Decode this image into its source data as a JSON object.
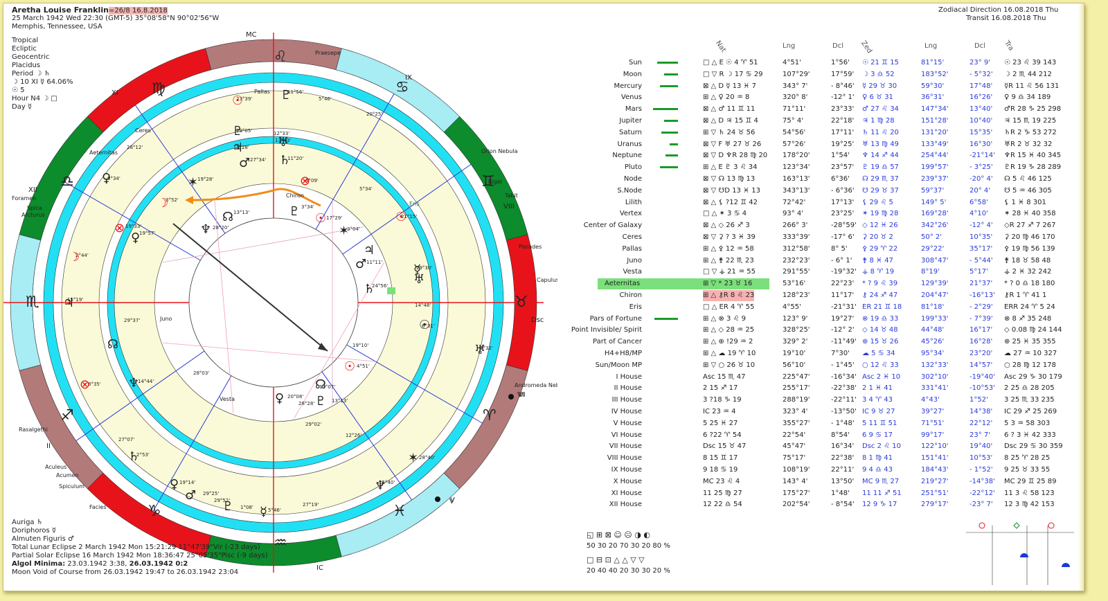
{
  "header": {
    "name": "Aretha Louise Franklin",
    "name_suffix": "=26/8 16.8.2018",
    "date_line": "25 March 1942  Wed  22:30 (GMT-5) 35°08'58\"N  90°02'56\"W",
    "place": "Memphis, Tennessee, USA",
    "settings": [
      "Tropical",
      "Ecliptic",
      "Geocentric",
      "Placidus"
    ],
    "period": "Period ☽ ♄",
    "period2": "☽ 10 XI ☿ 64.06%",
    "period3": "☉ 5",
    "hour": "Hour N4 ☽ □",
    "day": "Day ☿"
  },
  "top_right": {
    "line1": "Zodiacal Direction 16.08.2018  Thu",
    "line2": "Transit 16.08.2018  Thu"
  },
  "bottom_left": {
    "auriga": "Auriga ♄",
    "doriphoros": "Doriphoros ☿",
    "almuten": "Almuten Figuris ♂",
    "lunar": "Total Lunar Eclipse 2 March 1942 Mon 1",
    "lunar_tail": "5:21:29 11°47'39\"Vir (-23 days)",
    "solar": "Partial Solar Eclipse 16 March 1942 Mon 18:36:47 25°05'35\"Pisc (-9 days)",
    "algol_label": "Algol Minima:",
    "algol_vals": "23.03.1942  3:38,",
    "algol_bold": "26.03.1942  0:2",
    "void": "Moon Void of Course from 26.03.1942 19:47 to 26.03.1942 23:04"
  },
  "bottom_stats": {
    "row1_symbols": "◱ ⊞ ⊠   ☺ ☹ ◑ ◐",
    "row1_vals": "50  30  20    70  30  20  80 %",
    "row2_symbols": "□ ⊟ ⊡   △ △ ▽ ▽",
    "row2_vals": "20  40  40    20  30  30  20 %"
  },
  "table_headers": {
    "nat": "Nat",
    "lng": "Lng",
    "dcl": "Dcl",
    "zed": "Zed",
    "tra": "Tra"
  },
  "rows": [
    {
      "label": "Sun",
      "nat": "□ △ E ☉  4 ♈ 51",
      "lng": "4°51'",
      "dcl": "1°56'",
      "zed": "☉  21 ♊ 15",
      "zlng": "81°15'",
      "zdcl": "23° 9'",
      "tra": "☉ 23 ♌ 39  143"
    },
    {
      "label": "Moon",
      "nat": "□ ▽ R ☽  17 ♋ 29",
      "lng": "107°29'",
      "dcl": "17°59'",
      "zed": "☽  3 ♎ 52",
      "zlng": "183°52'",
      "zdcl": "- 5°32'",
      "tra": "☽ 2 ♏ 44  212"
    },
    {
      "label": "Mercury",
      "nat": "⊠ △ D ☿  13 ♓  7",
      "lng": "343° 7'",
      "dcl": "- 8°46'",
      "zed": "☿  29 ♉ 30",
      "zlng": "59°30'",
      "zdcl": "17°48'",
      "tra": "☿R 11 ♌ 56  131"
    },
    {
      "label": "Venus",
      "nat": "⊞ △   ♀  20 ♒  8",
      "lng": "320° 8'",
      "dcl": "-12° 1'",
      "zed": "♀  6 ♉ 31",
      "zlng": "36°31'",
      "zdcl": "16°26'",
      "tra": "♀ 9 ♎ 34  189"
    },
    {
      "label": "Mars",
      "nat": "⊠ △   ♂  11 ♊ 11",
      "lng": "71°11'",
      "dcl": "23°33'",
      "zed": "♂  27 ♌ 34",
      "zlng": "147°34'",
      "zdcl": "13°40'",
      "tra": "♂R 28 ♑ 25  298"
    },
    {
      "label": "Jupiter",
      "nat": "⊠ △ D ♃  15 ♊  4",
      "lng": "75° 4'",
      "dcl": "22°18'",
      "zed": "♃  1 ♍ 28",
      "zlng": "151°28'",
      "zdcl": "10°40'",
      "tra": "♃ 15 ♏ 19  225"
    },
    {
      "label": "Saturn",
      "nat": "⊞ ▽   ♄  24 ♉ 56",
      "lng": "54°56'",
      "dcl": "17°11'",
      "zed": "♄  11 ♌ 20",
      "zlng": "131°20'",
      "zdcl": "15°35'",
      "tra": "♄R 2 ♑ 53  272"
    },
    {
      "label": "Uranus",
      "nat": "⊠ ▽ F ♅  27 ♉ 26",
      "lng": "57°26'",
      "dcl": "19°25'",
      "zed": "♅  13 ♍ 49",
      "zlng": "133°49'",
      "zdcl": "16°30'",
      "tra": "♅R 2 ♉ 32  32"
    },
    {
      "label": "Neptune",
      "nat": "⊠ ▽ D ♆R 28 ♍ 20",
      "lng": "178°20'",
      "dcl": "1°54'",
      "zed": "♆  14 ♐ 44",
      "zlng": "254°44'",
      "zdcl": "-21°14'",
      "tra": "♆R 15 ♓ 40  345"
    },
    {
      "label": "Pluto",
      "nat": "⊞ △ E ♇  3 ♌ 34",
      "lng": "123°34'",
      "dcl": "23°57'",
      "zed": "♇  19 ♎ 57",
      "zlng": "199°57'",
      "zdcl": "- 3°25'",
      "tra": "♇R 19 ♑ 28  289"
    },
    {
      "label": "Node",
      "nat": "⊠ ▽   ☊  13 ♍ 13",
      "lng": "163°13'",
      "dcl": "6°36'",
      "zed": "☊  29 ♏ 37",
      "zlng": "239°37'",
      "zdcl": "-20° 4'",
      "tra": "☊ 5 ♌ 46  125"
    },
    {
      "label": "S.Node",
      "nat": "⊠ ▽   ☋D 13 ♓ 13",
      "lng": "343°13'",
      "dcl": "- 6°36'",
      "zed": "☋  29 ♉ 37",
      "zlng": "59°37'",
      "zdcl": "20° 4'",
      "tra": "☋ 5 ♒ 46  305"
    },
    {
      "label": "Lilith",
      "nat": "⊠ △   ⚸ ?12 ♊ 42",
      "lng": "72°42'",
      "dcl": "17°13'",
      "zed": "⚸  29 ♌  5",
      "zlng": "149° 5'",
      "zdcl": "6°58'",
      "tra": "⚸ 1 ♓  8  301"
    },
    {
      "label": "Vertex",
      "nat": "□ △   ✶  3 ♋  4",
      "lng": "93° 4'",
      "dcl": "23°25'",
      "zed": "✶  19 ♍ 28",
      "zlng": "169°28'",
      "zdcl": "4°10'",
      "tra": "✶ 28 ♓ 40  358"
    },
    {
      "label": "Center of Galaxy",
      "nat": "⊠ △   ◇  26 ♐  3",
      "lng": "266° 3'",
      "dcl": "-28°59'",
      "zed": "◇  12 ♓ 26",
      "zlng": "342°26'",
      "zdcl": "-12° 4'",
      "tra": "◇R 27 ♐  7  267"
    },
    {
      "label": "Ceres",
      "nat": "⊠ ▽   ⚳  ? 3 ♓ 39",
      "lng": "333°39'",
      "dcl": "-17° 6'",
      "zed": "⚳  20 ♉  2",
      "zlng": "50° 2'",
      "zdcl": "10°35'",
      "tra": "⚳ 20 ♍ 46  170"
    },
    {
      "label": "Pallas",
      "nat": "⊞ △   ⚴  12 ♒ 58",
      "lng": "312°58'",
      "dcl": "8° 5'",
      "zed": "⚴  29 ♈ 22",
      "zlng": "29°22'",
      "zdcl": "35°17'",
      "tra": "⚴ 19 ♍ 56  139"
    },
    {
      "label": "Juno",
      "nat": "⊞ △   ⚵  22 ♏ 23",
      "lng": "232°23'",
      "dcl": "- 6° 1'",
      "zed": "⚵  8 ♓ 47",
      "zlng": "308°47'",
      "zdcl": "- 5°44'",
      "tra": "⚵ 18 ♉ 58  48"
    },
    {
      "label": "Vesta",
      "nat": "□ ▽   ⚶  21 ♒ 55",
      "lng": "291°55'",
      "dcl": "-19°32'",
      "zed": "⚶  8 ♈ 19",
      "zlng": "8°19'",
      "zdcl": "5°17'",
      "tra": "⚶ 2 ♓ 32  242"
    },
    {
      "label": "Aeternitas",
      "nat": "⊞ ▽   *  23 ♉ 16",
      "lng": "53°16'",
      "dcl": "22°23'",
      "zed": "* ? 9 ♌ 39",
      "zlng": "129°39'",
      "zdcl": "21°37'",
      "tra": "* ? 0 ♎ 18  180"
    },
    {
      "label": "Chiron",
      "nat": "⊞ △   ⚷R 8 ♌ 23",
      "lng": "128°23'",
      "dcl": "11°17'",
      "zed": "⚷  24 ♐ 47",
      "zlng": "204°47'",
      "zdcl": "-16°13'",
      "tra": "⚷R 1 ♈ 41  1"
    },
    {
      "label": "Eris",
      "nat": "□ △   ER  4 ♈ 55",
      "lng": "4°55'",
      "dcl": "-21°31'",
      "zed": "ER  21 ♊ 18",
      "zlng": "81°18'",
      "zdcl": "- 2°29'",
      "tra": "ERR 24 ♈  5  24"
    },
    {
      "label": "Pars of Fortune",
      "nat": "⊞ △   ⊗  3 ♌  9",
      "lng": "123° 9'",
      "dcl": "19°27'",
      "zed": "⊗  19 ♎ 33",
      "zlng": "199°33'",
      "zdcl": "- 7°39'",
      "tra": "⊗ 8 ♐ 35  248"
    },
    {
      "label": "Point Invisible/ Spirit",
      "nat": "⊞ △   ◇  28 ♒ 25",
      "lng": "328°25'",
      "dcl": "-12° 2'",
      "zed": "◇  14 ♉ 48",
      "zlng": "44°48'",
      "zdcl": "16°17'",
      "tra": "◇ 0.08 ♍ 24  144"
    },
    {
      "label": "Part of Cancer",
      "nat": "⊞ △   ⊕ !29 ♒  2",
      "lng": "329° 2'",
      "dcl": "-11°49'",
      "zed": "⊕  15 ♉ 26",
      "zlng": "45°26'",
      "zdcl": "16°28'",
      "tra": "⊕ 25 ♓ 35  355"
    },
    {
      "label": "H4+H8/MP",
      "nat": "⊞ △   ☁  19 ♈ 10",
      "lng": "19°10'",
      "dcl": "7°30'",
      "zed": "☁  5 ♋ 34",
      "zlng": "95°34'",
      "zdcl": "23°20'",
      "tra": "☁ 27 ♒ 10  327"
    },
    {
      "label": "Sun/Moon MP",
      "nat": "⊞ ▽   ○  26 ♉ 10",
      "lng": "56°10'",
      "dcl": "- 1°45'",
      "zed": "○  12 ♌ 33",
      "zlng": "132°33'",
      "zdcl": "14°57'",
      "tra": "○ 28 ♍ 12  178"
    },
    {
      "label": "I House",
      "nat": "Asc 15 ♏ 47",
      "lng": "225°47'",
      "dcl": "-16°34'",
      "zed": "Asc 2 ♓ 10",
      "zlng": "302°10'",
      "zdcl": "-19°40'",
      "tra": "Asc 29 ♑ 30  179"
    },
    {
      "label": "II House",
      "nat": "2  15 ♐ 17",
      "lng": "255°17'",
      "dcl": "-22°38'",
      "zed": "2  1 ♓ 41",
      "zlng": "331°41'",
      "zdcl": "-10°53'",
      "tra": "2  25 ♎ 28  205"
    },
    {
      "label": "III House",
      "nat": "3  ?18 ♑ 19",
      "lng": "288°19'",
      "dcl": "-22°11'",
      "zed": "3  4 ♈ 43",
      "zlng": "4°43'",
      "zdcl": "1°52'",
      "tra": "3  25 ♏ 33  235"
    },
    {
      "label": "IV House",
      "nat": "IC 23 ♒  4",
      "lng": "323° 4'",
      "dcl": "-13°50'",
      "zed": "IC 9 ♉ 27",
      "zlng": "39°27'",
      "zdcl": "14°38'",
      "tra": "IC 29 ♐ 25  269"
    },
    {
      "label": "V House",
      "nat": "5  25 ♓ 27",
      "lng": "355°27'",
      "dcl": "- 1°48'",
      "zed": "5  11 ♊ 51",
      "zlng": "71°51'",
      "zdcl": "22°12'",
      "tra": "5  3 ♒ 58  303"
    },
    {
      "label": "VI House",
      "nat": "6 ?22 ♈ 54",
      "lng": "22°54'",
      "dcl": "8°54'",
      "zed": "6  9 ♋ 17",
      "zlng": "99°17'",
      "zdcl": "23° 7'",
      "tra": "6 ? 3 ♓ 42  333"
    },
    {
      "label": "VII House",
      "nat": "Dsc 15 ♉ 47",
      "lng": "45°47'",
      "dcl": "16°34'",
      "zed": "Dsc 2 ♌ 10",
      "zlng": "122°10'",
      "zdcl": "19°40'",
      "tra": "Dsc 29 ♋ 30  359"
    },
    {
      "label": "VIII House",
      "nat": "8  15 ♊ 17",
      "lng": "75°17'",
      "dcl": "22°38'",
      "zed": "8  1 ♍ 41",
      "zlng": "151°41'",
      "zdcl": "10°53'",
      "tra": "8  25 ♈ 28  25"
    },
    {
      "label": "IX House",
      "nat": "9  18 ♋ 19",
      "lng": "108°19'",
      "dcl": "22°11'",
      "zed": "9  4 ♎ 43",
      "zlng": "184°43'",
      "zdcl": "- 1°52'",
      "tra": "9  25 ♉ 33  55"
    },
    {
      "label": "X House",
      "nat": "MC 23 ♌  4",
      "lng": "143° 4'",
      "dcl": "13°50'",
      "zed": "MC 9 ♏ 27",
      "zlng": "219°27'",
      "zdcl": "-14°38'",
      "tra": "MC 29 ♊ 25  89"
    },
    {
      "label": "XI House",
      "nat": "11 25 ♍ 27",
      "lng": "175°27'",
      "dcl": "1°48'",
      "zed": "11 11 ♐ 51",
      "zlng": "251°51'",
      "zdcl": "-22°12'",
      "tra": "11 3 ♌ 58  123"
    },
    {
      "label": "XII House",
      "nat": "12 22 ♎ 54",
      "lng": "202°54'",
      "dcl": "- 8°54'",
      "zed": "12 9 ♑ 17",
      "zlng": "279°17'",
      "zdcl": "-23° 7'",
      "tra": "12 3 ♍ 42  153"
    }
  ],
  "chart_labels": {
    "mc": "MC",
    "ic": "IC",
    "dsc": "Dsc",
    "asc_roman": "XII",
    "houses": [
      "XI",
      "IX",
      "VIII",
      "VI",
      "V",
      "II"
    ],
    "stars": [
      "Praesepe",
      "Orion Nebula",
      "Rigel",
      "Tabit",
      "Pleiades",
      "Capulus",
      "Andromeda Nebula",
      "Foramen",
      "Spica",
      "Arcturus",
      "Rasalgethi",
      "Aculeus",
      "Acumen",
      "Spiculum",
      "Facies"
    ],
    "bodies": [
      {
        "t": "Pallas",
        "c": "#222"
      },
      {
        "t": "Ceres",
        "c": "#222"
      },
      {
        "t": "Aeternitas",
        "c": "#222"
      },
      {
        "t": "Chiron",
        "c": "#222"
      },
      {
        "t": "Eris",
        "c": "#1a8a2a"
      },
      {
        "t": "Juno",
        "c": "#222"
      },
      {
        "t": "Vesta",
        "c": "#222"
      }
    ],
    "degree_labels": [
      "23°39'",
      "11°56'",
      "5°46'",
      "20°25'",
      "29°05'",
      "12°33'",
      "13°43'",
      "11°20'",
      "1°28'",
      "27°34'",
      "19°28'",
      "3°09'",
      "3°52'",
      "13°13'",
      "28°20'",
      "3°34'",
      "17°29'",
      "3°04'",
      "21°15'",
      "19°33'",
      "19°57'",
      "2°44'",
      "15°19'",
      "11°11'",
      "29°30'",
      "24°56'",
      "14°48'",
      "6°31'",
      "29°37'",
      "28°03'",
      "19°10'",
      "4°51'",
      "2°32'",
      "8°35'",
      "14°44'",
      "13°07'",
      "20°08'",
      "28°28'",
      "13°13'",
      "29°02'",
      "12°26'",
      "27°07'",
      "2°53'",
      "19°14'",
      "29°25'",
      "29°52'",
      "1°08'",
      "5°46'",
      "27°19'",
      "15°40'",
      "28°40'",
      "9°34'",
      "28°12'",
      "5°34'"
    ]
  },
  "colors": {
    "red": "#e8131a",
    "green": "#0c8c2c",
    "brown": "#b37a7a",
    "lightblue": "#a8ecf4",
    "cyan": "#22e0f4",
    "cream": "#fafad8",
    "blue": "#2a3ad8"
  }
}
